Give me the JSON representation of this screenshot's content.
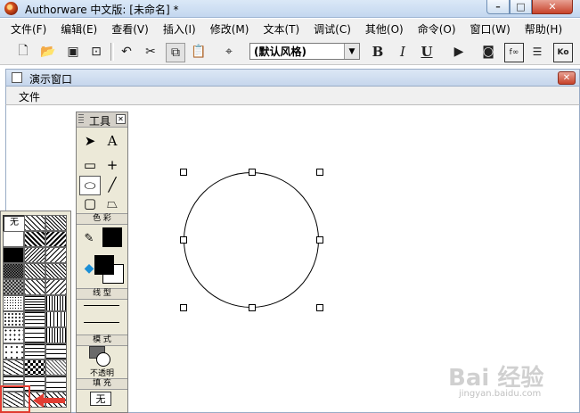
{
  "window": {
    "title": "Authorware 中文版: [未命名] *"
  },
  "menubar": {
    "items": [
      "文件(F)",
      "编辑(E)",
      "查看(V)",
      "插入(I)",
      "修改(M)",
      "文本(T)",
      "调试(C)",
      "其他(O)",
      "命令(O)",
      "窗口(W)",
      "帮助(H)"
    ]
  },
  "toolbar": {
    "style_select": "(默认风格)",
    "bold": "B",
    "italic": "I",
    "underline": "U",
    "functions_label": "f∞",
    "ko_label": "Ko"
  },
  "presentation": {
    "title": "演示窗口",
    "menu_file": "文件"
  },
  "tools_palette": {
    "title": "工具",
    "text_tool": "A",
    "color_label": "色 彩",
    "line_label": "线 型",
    "mode_label": "模 式",
    "mode_value": "不透明",
    "fill_label": "填 充",
    "fill_value": "无"
  },
  "fill_palette": {
    "none_label": "无"
  },
  "watermark": {
    "logo": "Bai 经验",
    "url": "jingyan.baidu.com"
  },
  "colors": {
    "accent_red": "#e03c31",
    "title_blue": "#c3d7ef"
  }
}
